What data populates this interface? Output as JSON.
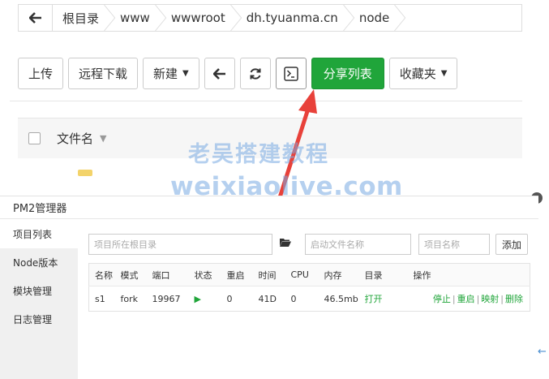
{
  "breadcrumb": {
    "items": [
      "根目录",
      "www",
      "wwwroot",
      "dh.tyuanma.cn",
      "node"
    ]
  },
  "toolbar": {
    "upload": "上传",
    "remote_download": "远程下载",
    "new": "新建",
    "share_list": "分享列表",
    "favorites": "收藏夹"
  },
  "file_list": {
    "column_filename": "文件名"
  },
  "watermark": {
    "line1": "老吴搭建教程",
    "line2": "weixiaolive.com"
  },
  "pm2": {
    "title": "PM2管理器",
    "sidebar": [
      "项目列表",
      "Node版本",
      "模块管理",
      "日志管理"
    ],
    "search": {
      "root_placeholder": "项目所在根目录",
      "startfile_placeholder": "启动文件名称",
      "name_placeholder": "项目名称",
      "add_label": "添加"
    },
    "table": {
      "headers": [
        "名称",
        "模式",
        "端口",
        "状态",
        "重启",
        "时间",
        "CPU",
        "内存",
        "目录",
        "操作"
      ],
      "rows": [
        {
          "name": "s1",
          "mode": "fork",
          "port": "19967",
          "restart": "0",
          "time": "41D",
          "cpu": "0",
          "memory": "46.5mb",
          "dir": "打开",
          "ops": [
            "停止",
            "重启",
            "映射",
            "删除"
          ]
        }
      ]
    }
  },
  "colors": {
    "primary_green": "#20a53a",
    "arrow_red": "#e8413a",
    "watermark_blue": "#78aae1"
  }
}
